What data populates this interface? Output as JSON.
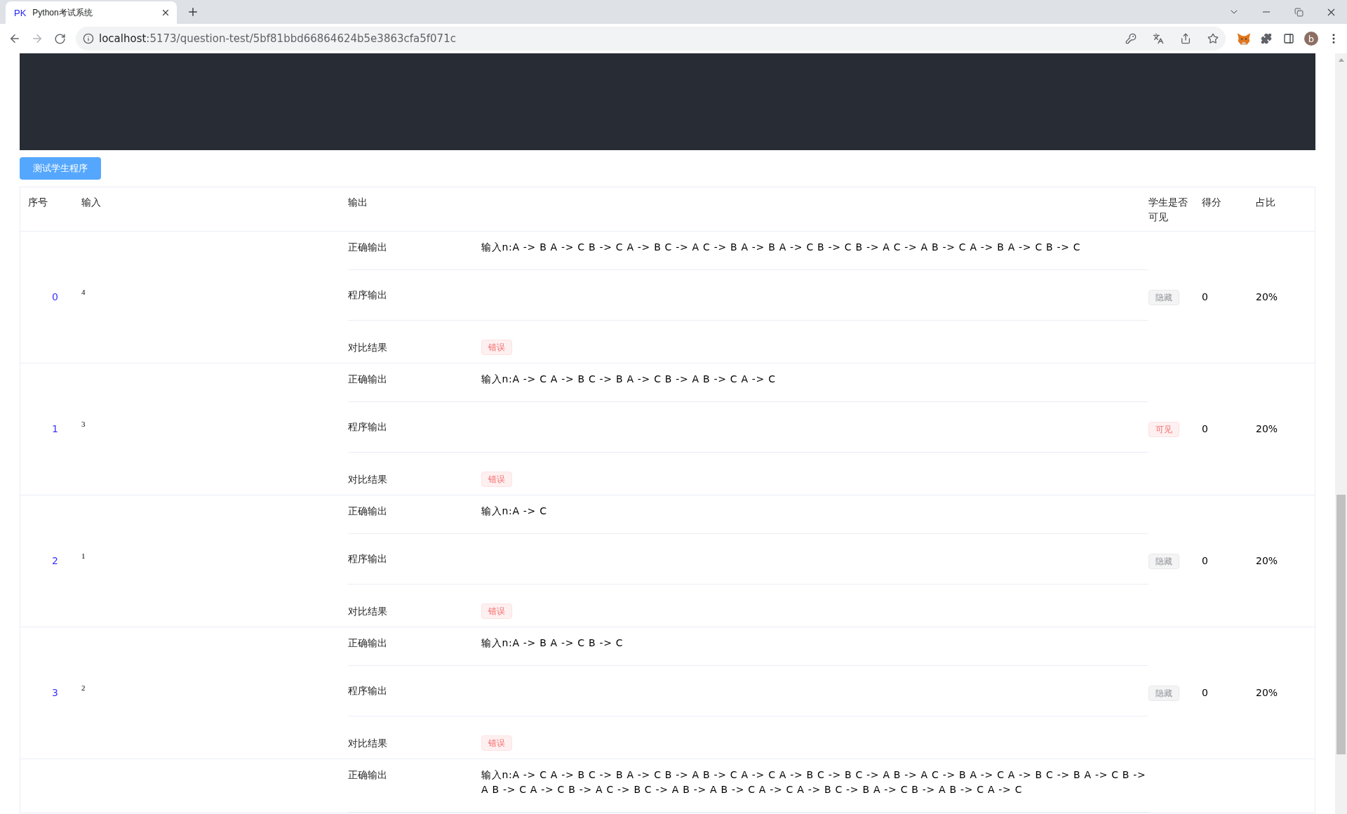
{
  "browser": {
    "tab": {
      "favicon": "PK",
      "title": "Python考试系统",
      "selected": true
    },
    "address": {
      "host": "localhost",
      "path": ":5173/question-test/5bf81bbd66864624b5e3863cfa5f071c"
    },
    "profile": "b"
  },
  "actions": {
    "test_button": "测试学生程序"
  },
  "table": {
    "columns": [
      "序号",
      "输入",
      "输出",
      "学生是否可见",
      "得分",
      "占比"
    ],
    "rows": [
      {
        "index": "0",
        "input": "4",
        "outputs": [
          {
            "kind": "text",
            "label": "正确输出",
            "value": "输入n:A -> B A -> C B -> C A -> B C -> A C -> B A -> B A -> C B -> C B -> A C -> A B -> C A -> B A -> C B -> C"
          },
          {
            "kind": "text",
            "label": "程序输出"
          },
          {
            "kind": "tag",
            "label": "对比结果",
            "value": "错误",
            "passed": false
          }
        ],
        "visibility": {
          "label": "隐藏",
          "visible": false
        },
        "score": "0",
        "share": "20%"
      },
      {
        "index": "1",
        "input": "3",
        "outputs": [
          {
            "kind": "text",
            "label": "正确输出",
            "value": "输入n:A -> C A -> B C -> B A -> C B -> A B -> C A -> C"
          },
          {
            "kind": "text",
            "label": "程序输出"
          },
          {
            "kind": "tag",
            "label": "对比结果",
            "value": "错误",
            "passed": false
          }
        ],
        "visibility": {
          "label": "可见",
          "visible": true
        },
        "score": "0",
        "share": "20%"
      },
      {
        "index": "2",
        "input": "1",
        "outputs": [
          {
            "kind": "text",
            "label": "正确输出",
            "value": "输入n:A -> C"
          },
          {
            "kind": "text",
            "label": "程序输出"
          },
          {
            "kind": "tag",
            "label": "对比结果",
            "value": "错误",
            "passed": false
          }
        ],
        "visibility": {
          "label": "隐藏",
          "visible": false
        },
        "score": "0",
        "share": "20%"
      },
      {
        "index": "3",
        "input": "2",
        "outputs": [
          {
            "kind": "text",
            "label": "正确输出",
            "value": "输入n:A -> B A -> C B -> C"
          },
          {
            "kind": "text",
            "label": "程序输出"
          },
          {
            "kind": "tag",
            "label": "对比结果",
            "value": "错误",
            "passed": false
          }
        ],
        "visibility": {
          "label": "隐藏",
          "visible": false
        },
        "score": "0",
        "share": "20%"
      },
      {
        "outputs": [
          {
            "kind": "text",
            "label": "正确输出",
            "value": "输入n:A -> C A -> B C -> B A -> C B -> A B -> C A -> C A -> B C -> B C -> A B -> A C -> B A -> C A -> B C -> B A -> C B -> A B -> C A -> C B -> A C -> B C -> A B -> A B -> C A -> C A -> B C -> B A -> C B -> A B -> C A -> C"
          }
        ]
      }
    ]
  }
}
